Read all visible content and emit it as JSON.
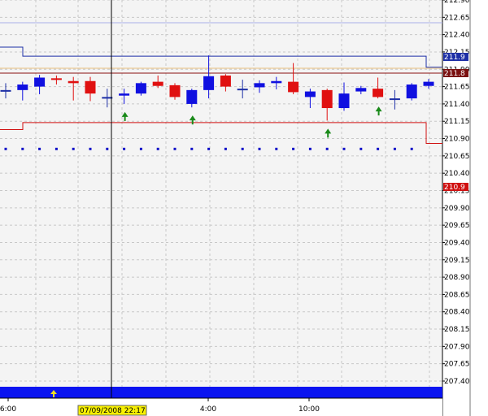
{
  "chart_data": {
    "type": "candlestick",
    "y_ticks": [
      "212.90",
      "212.65",
      "212.40",
      "212.15",
      "211.90",
      "211.65",
      "211.40",
      "211.15",
      "210.90",
      "210.65",
      "210.40",
      "210.15",
      "209.90",
      "209.65",
      "209.40",
      "209.15",
      "208.90",
      "208.65",
      "208.40",
      "208.15",
      "207.90",
      "207.65",
      "207.40"
    ],
    "ylim": [
      207.28,
      213.0
    ],
    "time_labels": [
      "6:00",
      "4:00",
      "10:00"
    ],
    "cursor_time_label": "07/09/2008 22:17",
    "price_tags": [
      {
        "value": "211.9",
        "color": "#1d2fa6"
      },
      {
        "value": "211.8",
        "color": "#7a1010"
      },
      {
        "value": "210.9",
        "color": "#d01010"
      }
    ],
    "candles": [
      {
        "o": 211.6,
        "h": 211.7,
        "l": 211.48,
        "c": 211.6,
        "dir": "flat"
      },
      {
        "o": 211.6,
        "h": 211.72,
        "l": 211.45,
        "c": 211.68,
        "dir": "up"
      },
      {
        "o": 211.65,
        "h": 211.82,
        "l": 211.54,
        "c": 211.78,
        "dir": "up"
      },
      {
        "o": 211.77,
        "h": 211.81,
        "l": 211.68,
        "c": 211.75,
        "dir": "down"
      },
      {
        "o": 211.73,
        "h": 211.79,
        "l": 211.45,
        "c": 211.7,
        "dir": "down"
      },
      {
        "o": 211.73,
        "h": 211.79,
        "l": 211.44,
        "c": 211.55,
        "dir": "down"
      },
      {
        "o": 211.5,
        "h": 211.62,
        "l": 211.35,
        "c": 211.5,
        "dir": "flat"
      },
      {
        "o": 211.52,
        "h": 211.62,
        "l": 211.4,
        "c": 211.55,
        "dir": "up"
      },
      {
        "o": 211.55,
        "h": 211.72,
        "l": 211.52,
        "c": 211.7,
        "dir": "up"
      },
      {
        "o": 211.72,
        "h": 211.81,
        "l": 211.63,
        "c": 211.66,
        "dir": "down"
      },
      {
        "o": 211.67,
        "h": 211.7,
        "l": 211.46,
        "c": 211.5,
        "dir": "down"
      },
      {
        "o": 211.4,
        "h": 211.62,
        "l": 211.35,
        "c": 211.6,
        "dir": "up"
      },
      {
        "o": 211.6,
        "h": 212.1,
        "l": 211.48,
        "c": 211.8,
        "dir": "up"
      },
      {
        "o": 211.81,
        "h": 211.83,
        "l": 211.58,
        "c": 211.65,
        "dir": "down"
      },
      {
        "o": 211.62,
        "h": 211.75,
        "l": 211.48,
        "c": 211.62,
        "dir": "flat"
      },
      {
        "o": 211.64,
        "h": 211.74,
        "l": 211.56,
        "c": 211.7,
        "dir": "up"
      },
      {
        "o": 211.7,
        "h": 211.79,
        "l": 211.61,
        "c": 211.73,
        "dir": "up"
      },
      {
        "o": 211.72,
        "h": 211.99,
        "l": 211.54,
        "c": 211.57,
        "dir": "down"
      },
      {
        "o": 211.5,
        "h": 211.62,
        "l": 211.34,
        "c": 211.58,
        "dir": "up"
      },
      {
        "o": 211.6,
        "h": 211.62,
        "l": 211.16,
        "c": 211.34,
        "dir": "down"
      },
      {
        "o": 211.34,
        "h": 211.71,
        "l": 211.3,
        "c": 211.55,
        "dir": "up"
      },
      {
        "o": 211.58,
        "h": 211.66,
        "l": 211.54,
        "c": 211.63,
        "dir": "up"
      },
      {
        "o": 211.62,
        "h": 211.78,
        "l": 211.48,
        "c": 211.5,
        "dir": "down"
      },
      {
        "o": 211.48,
        "h": 211.6,
        "l": 211.32,
        "c": 211.48,
        "dir": "flat"
      },
      {
        "o": 211.48,
        "h": 211.7,
        "l": 211.45,
        "c": 211.68,
        "dir": "up"
      },
      {
        "o": 211.66,
        "h": 211.76,
        "l": 211.62,
        "c": 211.72,
        "dir": "up"
      }
    ],
    "signal_candles": [
      7,
      11,
      19,
      22
    ],
    "upper_level": {
      "left": 212.22,
      "right": 212.09,
      "right_after": 211.93
    },
    "lower_level": {
      "left": 211.03,
      "right": 211.13,
      "right_after": 210.83
    },
    "dotted_level": 210.75,
    "colors": {
      "up": "#1010e0",
      "down": "#e01010",
      "flat": "#1d2fa6",
      "upper_level": "#1d2fa6",
      "lower_level": "#d01010",
      "dots": "#1010c8",
      "signal": "#1a8a1a",
      "bottom_bar": "#0a14f0",
      "axis_bg": "#ffffff",
      "plot_bg": "#f4f4f4"
    }
  }
}
